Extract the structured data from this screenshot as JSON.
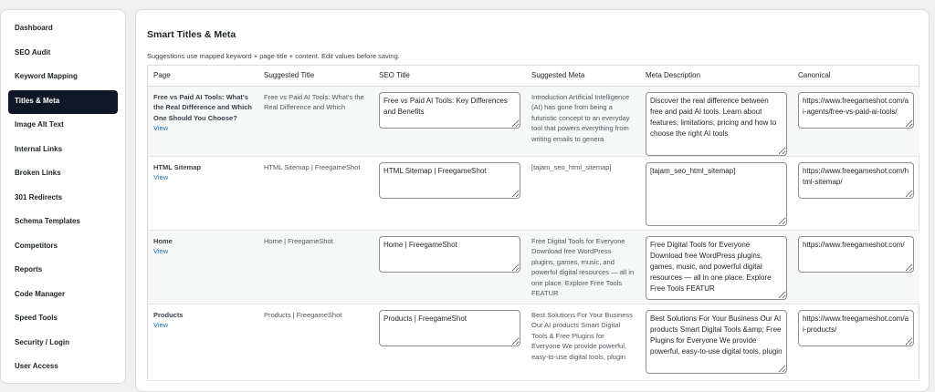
{
  "sidebar": {
    "items": [
      {
        "label": "Dashboard",
        "active": false
      },
      {
        "label": "SEO Audit",
        "active": false
      },
      {
        "label": "Keyword Mapping",
        "active": false
      },
      {
        "label": "Titles & Meta",
        "active": true
      },
      {
        "label": "Image Alt Text",
        "active": false
      },
      {
        "label": "Internal Links",
        "active": false
      },
      {
        "label": "Broken Links",
        "active": false
      },
      {
        "label": "301 Redirects",
        "active": false
      },
      {
        "label": "Schema Templates",
        "active": false
      },
      {
        "label": "Competitors",
        "active": false
      },
      {
        "label": "Reports",
        "active": false
      },
      {
        "label": "Code Manager",
        "active": false
      },
      {
        "label": "Speed Tools",
        "active": false
      },
      {
        "label": "Security / Login",
        "active": false
      },
      {
        "label": "User Access",
        "active": false
      }
    ]
  },
  "main": {
    "title": "Smart Titles & Meta",
    "subtitle": "Suggestions use mapped keyword + page title + content. Edit values before saving.",
    "columns": [
      "Page",
      "Suggested Title",
      "SEO Title",
      "Suggested Meta",
      "Meta Description",
      "Canonical"
    ],
    "view_label": "View",
    "rows": [
      {
        "page": "Free vs Paid AI Tools: What's the Real Difference and Which One Should You Choose?",
        "suggested_title": "Free vs Paid AI Tools: What's the Real Difference and Which",
        "seo_title": "Free vs Paid AI Tools: Key Differences and Benefits",
        "suggested_meta": "Introduction Artificial Intelligence (AI) has gone from being a futuristic concept to an everyday tool that powers everything from writing emails to genera",
        "meta_description": "Discover the real difference between free and paid AI tools. Learn about features, limitations, pricing and how to choose the right AI tools",
        "canonical": "https://www.freegameshot.com/ai-agents/free-vs-paid-ai-tools/"
      },
      {
        "page": "HTML Sitemap",
        "suggested_title": "HTML Sitemap | FreegameShot",
        "seo_title": "HTML Sitemap | FreegameShot",
        "suggested_meta": "[tajam_seo_html_sitemap]",
        "meta_description": "[tajam_seo_html_sitemap]",
        "canonical": "https://www.freegameshot.com/html-sitemap/"
      },
      {
        "page": "Home",
        "suggested_title": "Home | FreegameShot",
        "seo_title": "Home | FreegameShot",
        "suggested_meta": "Free Digital Tools for Everyone Download free WordPress plugins, games, music, and powerful digital resources — all in one place. Explore Free Tools FEATUR",
        "meta_description": "Free Digital Tools for Everyone Download free WordPress plugins, games, music, and powerful digital resources — all in one place. Explore Free Tools FEATUR",
        "canonical": "https://www.freegameshot.com/"
      },
      {
        "page": "Products",
        "suggested_title": "Products | FreegameShot",
        "seo_title": "Products | FreegameShot",
        "suggested_meta": "Best Solutions For Your Business Our AI products Smart Digital Tools & Free Plugins for Everyone We provide powerful, easy-to-use digital tools, plugin",
        "meta_description": "Best Solutions For Your Business Our AI products Smart Digital Tools &amp; Free Plugins for Everyone We provide powerful, easy-to-use digital tools, plugin",
        "canonical": "https://www.freegameshot.com/ai-products/"
      }
    ]
  },
  "colors": {
    "active_bg": "#101828",
    "link": "#2271b1",
    "page_bg": "#f0f0f1"
  }
}
